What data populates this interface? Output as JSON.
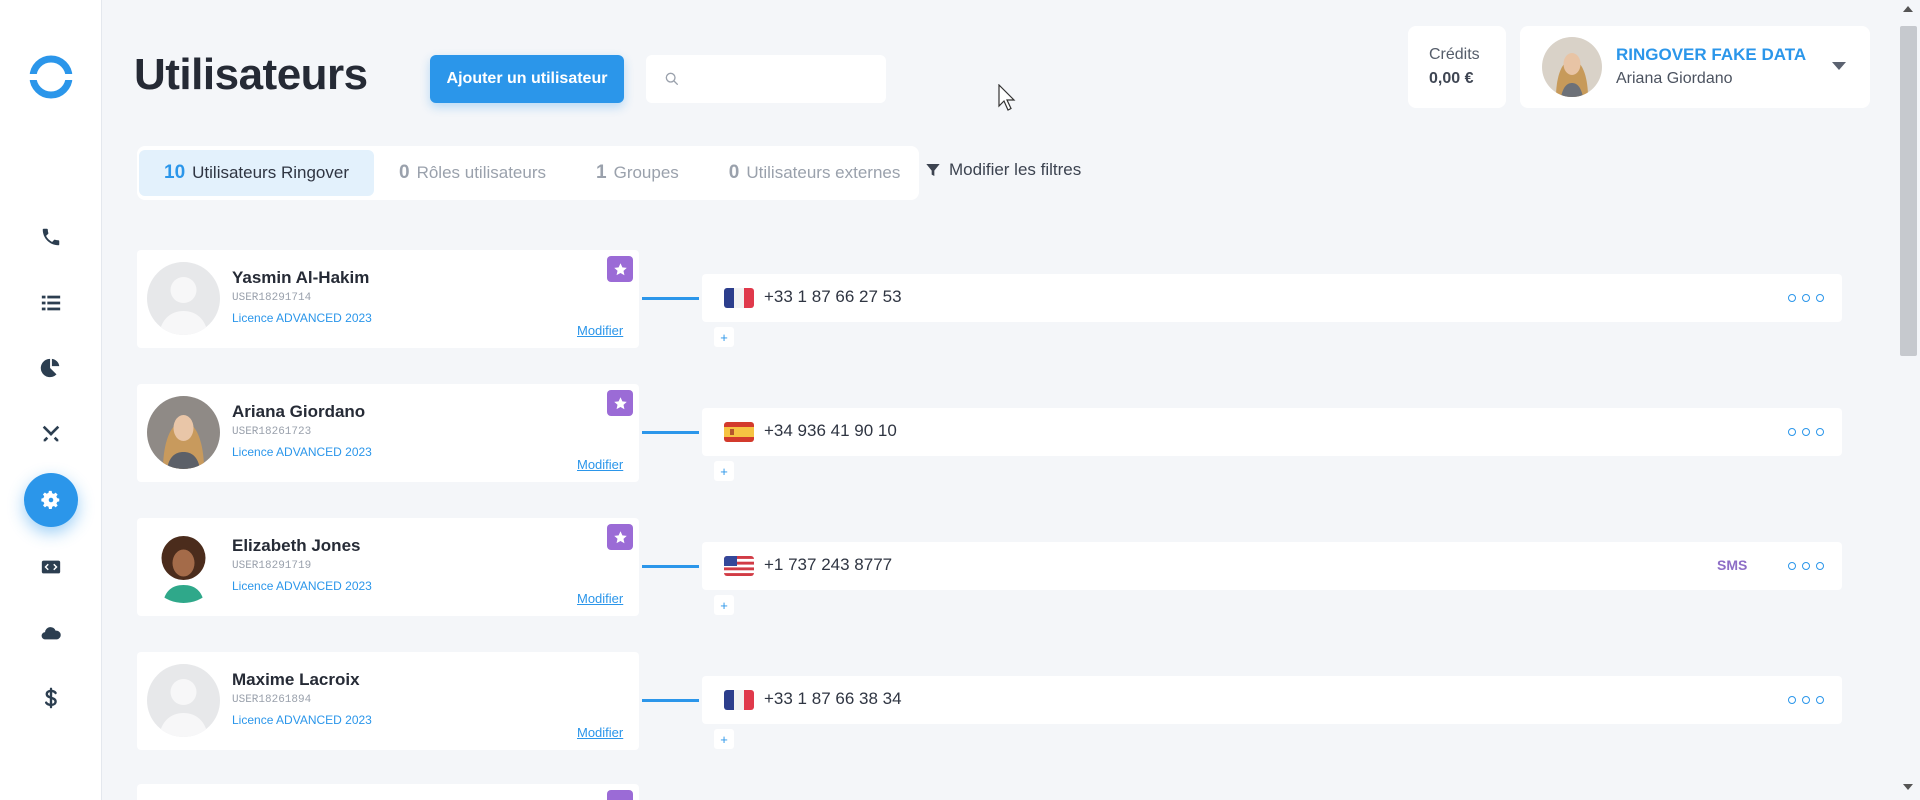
{
  "page": {
    "title": "Utilisateurs"
  },
  "toolbar": {
    "add_user_label": "Ajouter un utilisateur",
    "search_placeholder": ""
  },
  "credits": {
    "label": "Crédits",
    "value": "0,00 €"
  },
  "account": {
    "org": "RINGOVER FAKE DATA",
    "user": "Ariana Giordano"
  },
  "tabs": [
    {
      "count": "10",
      "label": "Utilisateurs Ringover",
      "active": true
    },
    {
      "count": "0",
      "label": "Rôles utilisateurs",
      "active": false
    },
    {
      "count": "1",
      "label": "Groupes",
      "active": false
    },
    {
      "count": "0",
      "label": "Utilisateurs externes",
      "active": false
    }
  ],
  "filter_label": "Modifier les filtres",
  "users": [
    {
      "name": "Yasmin Al-Hakim",
      "id": "USER18291714",
      "licence": "Licence ADVANCED 2023",
      "edit": "Modifier",
      "starred": true,
      "phone": "+33 1 87 66 27 53",
      "flag": "fr",
      "sms": "",
      "plus": "+"
    },
    {
      "name": "Ariana Giordano",
      "id": "USER18261723",
      "licence": "Licence ADVANCED 2023",
      "edit": "Modifier",
      "starred": true,
      "phone": "+34 936 41 90 10",
      "flag": "es",
      "sms": "",
      "plus": "+"
    },
    {
      "name": "Elizabeth Jones",
      "id": "USER18291719",
      "licence": "Licence ADVANCED 2023",
      "edit": "Modifier",
      "starred": true,
      "phone": "+1 737 243 8777",
      "flag": "us",
      "sms": "SMS",
      "plus": "+"
    },
    {
      "name": "Maxime Lacroix",
      "id": "USER18261894",
      "licence": "Licence ADVANCED 2023",
      "edit": "Modifier",
      "starred": false,
      "phone": "+33 1 87 66 38 34",
      "flag": "fr",
      "sms": "",
      "plus": "+"
    }
  ],
  "nav_icons": [
    "phone-icon",
    "list-icon",
    "pie-chart-icon",
    "tools-icon",
    "settings-icon",
    "code-icon",
    "cloud-icon",
    "dollar-icon"
  ],
  "colors": {
    "accent": "#2b96ea",
    "star": "#9b6bd6",
    "sms": "#8d6dc6"
  }
}
